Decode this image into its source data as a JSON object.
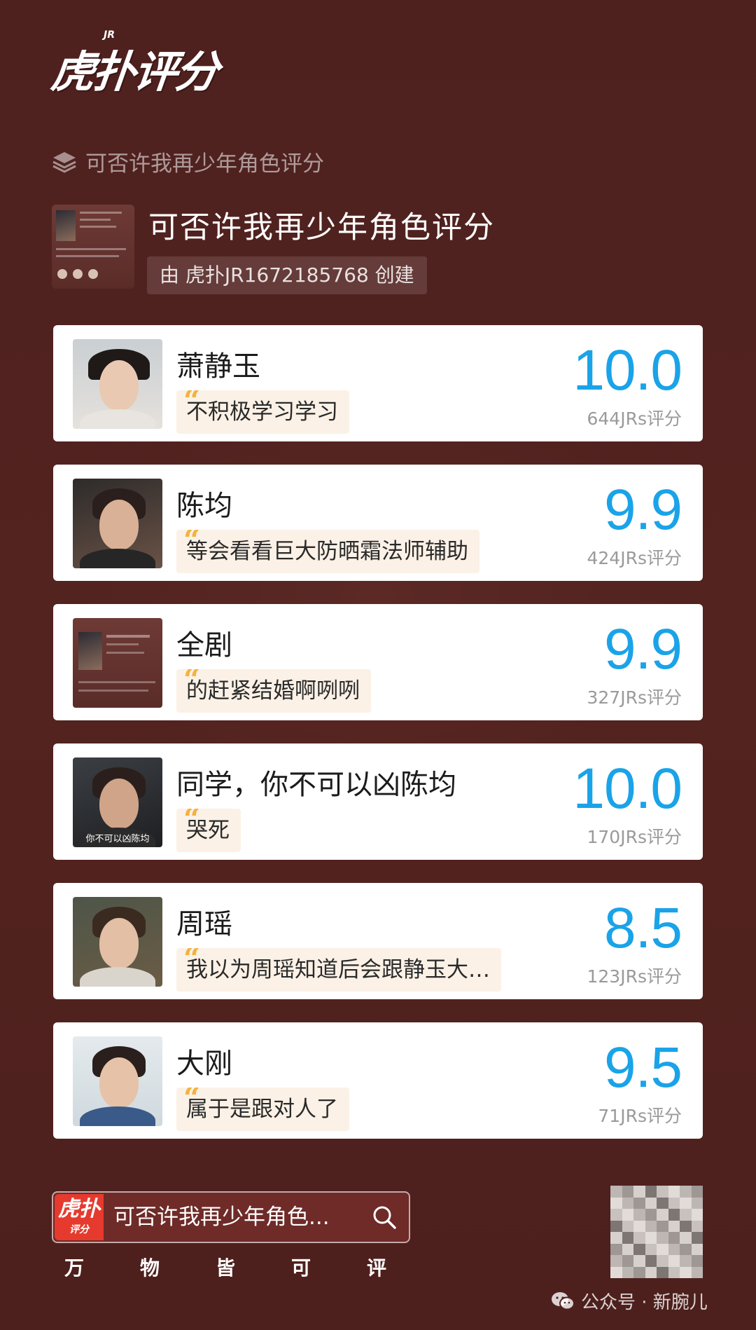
{
  "brand": {
    "logo_text": "虎扑评分",
    "logo_jr": "JR"
  },
  "topic": {
    "label": "可否许我再少年角色评分"
  },
  "header": {
    "title": "可否许我再少年角色评分",
    "creator": "由 虎扑JR1672185768 创建"
  },
  "cards": [
    {
      "name": "萧静玉",
      "quote": "不积极学习学习",
      "score": "10.0",
      "count": "644JRs评分"
    },
    {
      "name": "陈均",
      "quote": "等会看看巨大防晒霜法师辅助",
      "score": "9.9",
      "count": "424JRs评分"
    },
    {
      "name": "全剧",
      "quote": "的赶紧结婚啊咧咧",
      "score": "9.9",
      "count": "327JRs评分"
    },
    {
      "name": "同学，你不可以凶陈均",
      "quote": "哭死",
      "score": "10.0",
      "count": "170JRs评分",
      "avatar_caption": "你不可以凶陈均"
    },
    {
      "name": "周瑶",
      "quote": "我以为周瑶知道后会跟静玉大…",
      "score": "8.5",
      "count": "123JRs评分"
    },
    {
      "name": "大刚",
      "quote": "属于是跟对人了",
      "score": "9.5",
      "count": "71JRs评分"
    }
  ],
  "footer": {
    "logo_big": "虎扑",
    "logo_small": "评分",
    "search_text": "可否许我再少年角色...",
    "slogan": [
      "万",
      "物",
      "皆",
      "可",
      "评"
    ]
  },
  "watermark": {
    "text": "公众号 · 新腕儿"
  },
  "colors": {
    "background": "#4e211f",
    "score": "#1aa3e8",
    "quote_bg": "#fbf1e6",
    "quote_mark": "#f4b23e"
  }
}
